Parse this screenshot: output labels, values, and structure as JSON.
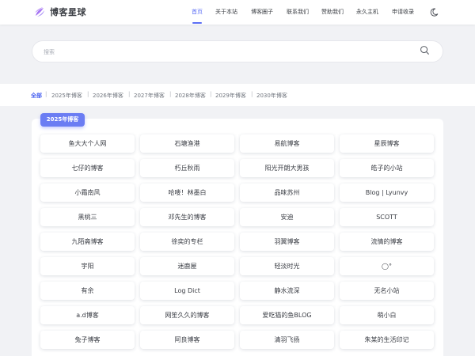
{
  "header": {
    "logo_text": "博客星球",
    "nav": [
      "首页",
      "关于本站",
      "博客圈子",
      "联系我们",
      "赞助我们",
      "永久主机",
      "申请收录"
    ],
    "active_index": 0,
    "accent_color": "#5b6ef5"
  },
  "search": {
    "placeholder": "搜索"
  },
  "year_tabs": [
    "全部",
    "2025年博客",
    "2026年博客",
    "2027年博客",
    "2028年博客",
    "2029年博客",
    "2030年博客"
  ],
  "section": {
    "title": "2025年博客",
    "sites": [
      "鱼大大个人网",
      "石塘渔港",
      "易航博客",
      "星辰博客",
      "七仔的博客",
      "朽丘秋雨",
      "阳光开朗大男孩",
      "皓子的小站",
      "小霜南风",
      "哈喽！林墨白",
      "品味苏州",
      "Blog | Lyunvy",
      "黑桃三",
      "邓先生的博客",
      "安迪",
      "SCOTT",
      "九陌斋博客",
      "徐奕的专栏",
      "羽翼博客",
      "流情的博客",
      "宇阳",
      "迷鹿屋",
      "轻淡时光",
      "◯°",
      "有余",
      "Log Dict",
      "静水流深",
      "无名小站",
      "a.d博客",
      "网笙久久的博客",
      "爱吃猫的鱼BLOG",
      "萌小白",
      "兔子博客",
      "阿良博客",
      "清羽飞扬",
      "朱某的生活印记"
    ]
  }
}
